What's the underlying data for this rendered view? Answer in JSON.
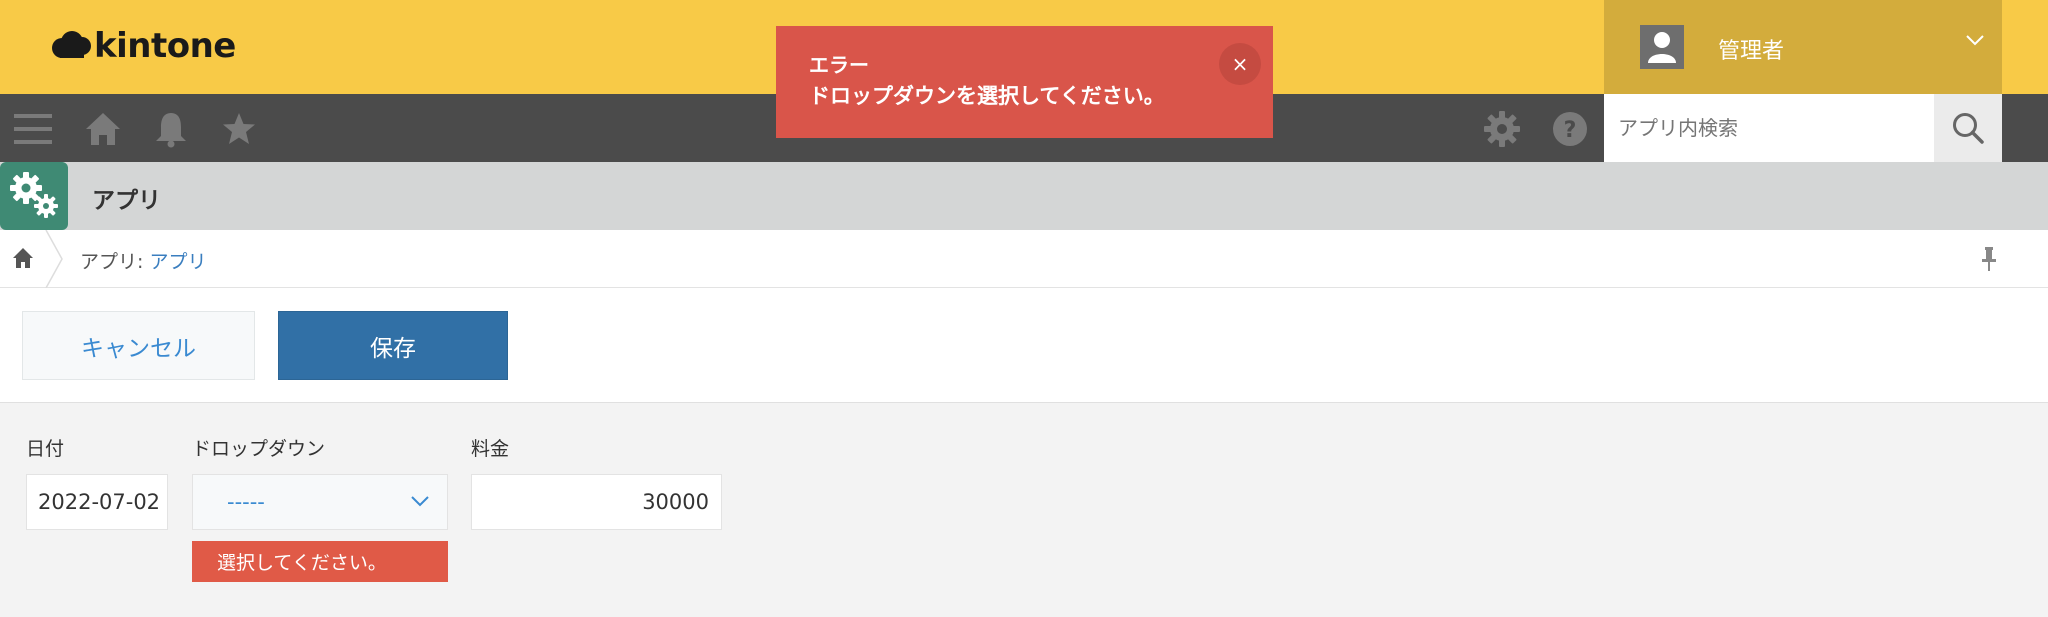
{
  "header": {
    "logo_text": "kintone",
    "user_name": "管理者",
    "colors": {
      "header_bg": "#f8ca47",
      "user_bg": "#d3ac3c",
      "toolbar_bg": "#4b4b4b"
    }
  },
  "toolbar": {
    "icons": [
      "menu-icon",
      "home-icon",
      "bell-icon",
      "star-icon",
      "gear-icon",
      "help-icon"
    ],
    "search_placeholder": "アプリ内検索"
  },
  "app": {
    "title": "アプリ"
  },
  "breadcrumb": {
    "prefix": "アプリ:",
    "link": "アプリ"
  },
  "actions": {
    "cancel_label": "キャンセル",
    "save_label": "保存"
  },
  "form": {
    "date": {
      "label": "日付",
      "value": "2022-07-02"
    },
    "dropdown": {
      "label": "ドロップダウン",
      "value": "-----",
      "error": "選択してください。"
    },
    "fee": {
      "label": "料金",
      "value": "30000"
    }
  },
  "toast": {
    "title": "エラー",
    "message": "ドロップダウンを選択してください。",
    "close_label": "×",
    "color": "#d9554a"
  }
}
